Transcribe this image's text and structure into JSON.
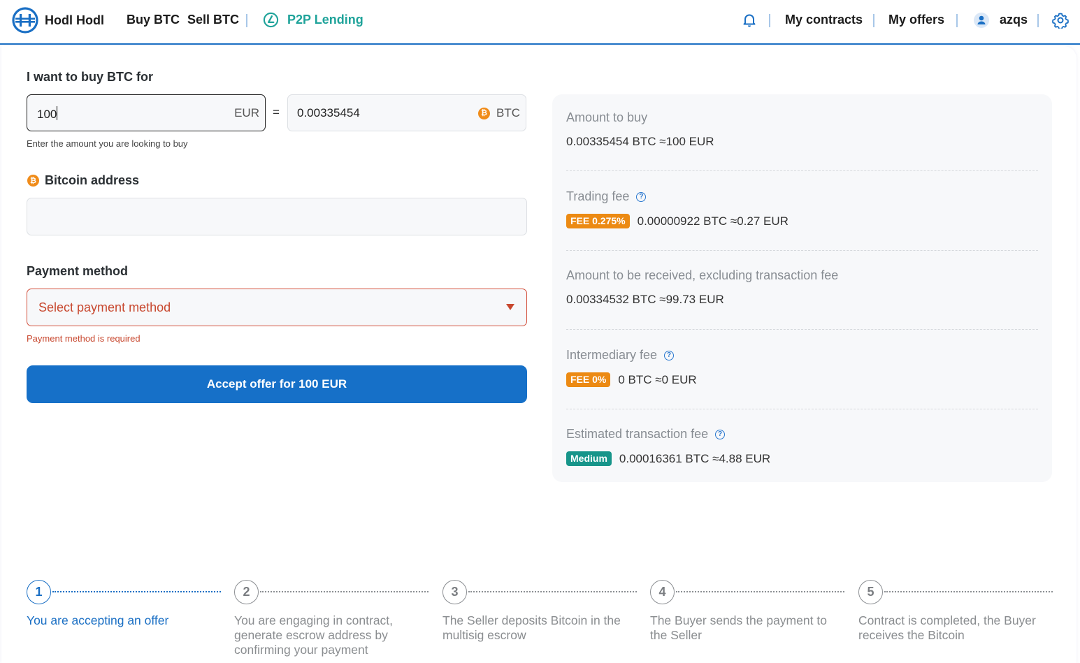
{
  "header": {
    "brand": "Hodl Hodl",
    "nav": [
      {
        "label": "Buy BTC"
      },
      {
        "label": "Sell BTC"
      }
    ],
    "p2p_lending": "P2P Lending",
    "my_contracts": "My contracts",
    "my_offers": "My offers",
    "username": "azqs",
    "colors": {
      "brand": "#1a6fc4",
      "p2p": "#1fa39a"
    }
  },
  "form": {
    "buy_label": "I want to buy BTC for",
    "fiat_amount": "100",
    "fiat_currency": "EUR",
    "equals": "=",
    "btc_amount": "0.00335454",
    "btc_currency": "BTC",
    "amount_hint": "Enter the amount you are looking to buy",
    "address_label": "Bitcoin address",
    "address_value": "",
    "payment_label": "Payment method",
    "payment_placeholder": "Select payment method",
    "payment_error": "Payment method is required",
    "accept_button": "Accept offer for 100 EUR",
    "colors": {
      "error": "#c8482f",
      "button": "#1670c8"
    }
  },
  "summary": {
    "amount_to_buy": {
      "title": "Amount to buy",
      "value": "0.00335454 BTC ≈100 EUR"
    },
    "trading_fee": {
      "title": "Trading fee",
      "badge": "FEE 0.275%",
      "value": "0.00000922 BTC ≈0.27 EUR"
    },
    "amount_received": {
      "title": "Amount to be received, excluding transaction fee",
      "value": "0.00334532 BTC ≈99.73 EUR"
    },
    "intermediary_fee": {
      "title": "Intermediary fee",
      "badge": "FEE 0%",
      "value": "0 BTC ≈0 EUR"
    },
    "transaction_fee": {
      "title": "Estimated transaction fee",
      "badge": "Medium",
      "value": "0.00016361 BTC ≈4.88 EUR"
    },
    "colors": {
      "fee_badge": "#ec8a13",
      "medium_badge": "#17958a"
    }
  },
  "steps": [
    {
      "number": "1",
      "text": "You are accepting an offer",
      "active": true
    },
    {
      "number": "2",
      "text": "You are engaging in contract, generate escrow address by confirming your payment",
      "active": false
    },
    {
      "number": "3",
      "text": "The Seller deposits Bitcoin in the multisig escrow",
      "active": false
    },
    {
      "number": "4",
      "text": "The Buyer sends the payment to the Seller",
      "active": false
    },
    {
      "number": "5",
      "text": "Contract is completed, the Buyer receives the Bitcoin",
      "active": false
    }
  ]
}
